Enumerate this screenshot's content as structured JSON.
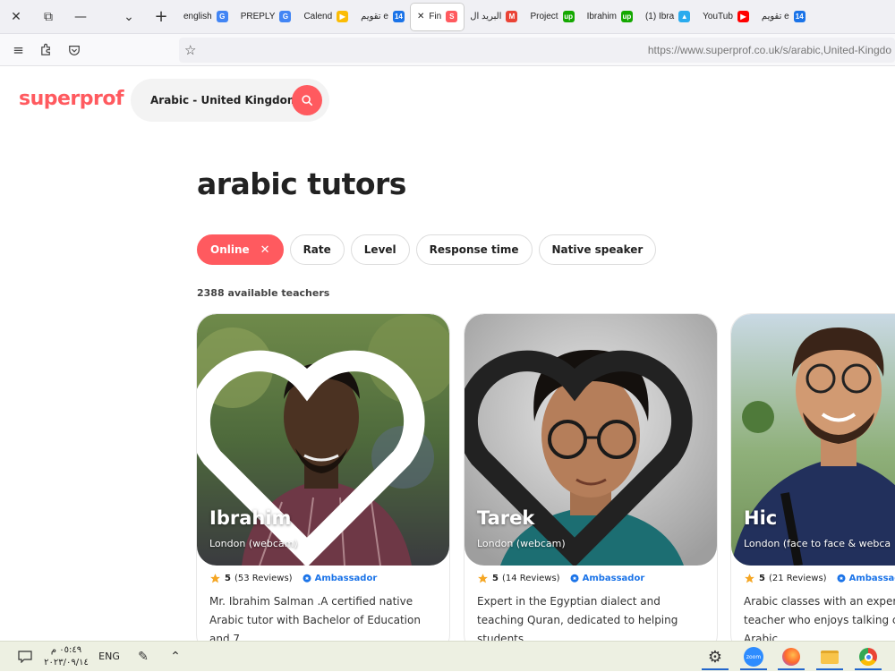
{
  "browser": {
    "tabs": [
      {
        "label": "english",
        "icon": "google-icon",
        "color": "#4285f4",
        "glyph": "G"
      },
      {
        "label": "PREPLY",
        "icon": "google-icon",
        "color": "#4285f4",
        "glyph": "G"
      },
      {
        "label": "Calend",
        "icon": "calendar-icon",
        "color": "#fbbc04",
        "glyph": "▶"
      },
      {
        "label": "تقويم e",
        "icon": "google-calendar-icon",
        "color": "#1a73e8",
        "glyph": "14"
      },
      {
        "label": "Fin",
        "icon": "superprof-icon",
        "color": "#ff5a5f",
        "glyph": "S",
        "active": true
      },
      {
        "label": "البريد ال",
        "icon": "gmail-icon",
        "color": "#ea4335",
        "glyph": "M"
      },
      {
        "label": "Project",
        "icon": "upwork-icon",
        "color": "#14a800",
        "glyph": "up"
      },
      {
        "label": "Ibrahim",
        "icon": "upwork-icon",
        "color": "#14a800",
        "glyph": "up"
      },
      {
        "label": "(1) Ibra",
        "icon": "telegram-icon",
        "color": "#2aabee",
        "glyph": "▲"
      },
      {
        "label": "YouTub",
        "icon": "youtube-icon",
        "color": "#ff0000",
        "glyph": "▶"
      },
      {
        "label": "تقويم e",
        "icon": "google-calendar-icon",
        "color": "#1a73e8",
        "glyph": "14"
      }
    ],
    "url": "https://www.superprof.co.uk/s/arabic,United-Kingdo"
  },
  "page": {
    "logo": "superprof",
    "search_value": "Arabic - United Kingdom",
    "title": "arabic tutors",
    "filters": [
      {
        "label": "Online",
        "active": true
      },
      {
        "label": "Rate",
        "active": false
      },
      {
        "label": "Level",
        "active": false
      },
      {
        "label": "Response time",
        "active": false
      },
      {
        "label": "Native speaker",
        "active": false
      }
    ],
    "count": "2388 available teachers",
    "tutors": [
      {
        "name": "Ibrahim",
        "location": "London (webcam)",
        "rating": "5",
        "reviews": "(53 Reviews)",
        "badge": "Ambassador",
        "description": "Mr. Ibrahim Salman .A certified native Arabic tutor with Bachelor of Education and 7"
      },
      {
        "name": "Tarek",
        "location": "London (webcam)",
        "rating": "5",
        "reviews": "(14 Reviews)",
        "badge": "Ambassador",
        "description": "Expert in the Egyptian dialect and teaching Quran, dedicated to helping students"
      },
      {
        "name": "Hic",
        "location": "London (face to face & webca",
        "rating": "5",
        "reviews": "(21 Reviews)",
        "badge": "Ambassad",
        "description": "Arabic classes with an exper teacher who enjoys talking c Arabic"
      }
    ]
  },
  "taskbar": {
    "time": "٠٥:٤٩ م",
    "date": "٢٠٢٣/٠٩/١٤",
    "lang": "ENG"
  },
  "colors": {
    "accent": "#ff5a5f",
    "ambassador": "#1a73e8",
    "star": "#f5a623"
  }
}
